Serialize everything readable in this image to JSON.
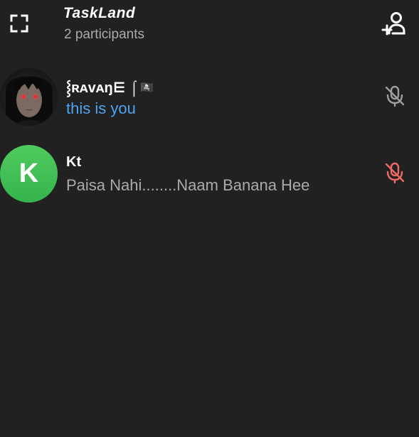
{
  "header": {
    "title": "TaskLand",
    "subtitle": "2 participants",
    "fullscreen_icon": "fullscreen-icon",
    "add_participant_icon": "add-user-icon"
  },
  "participants": [
    {
      "name": "⸾ʀᴀᴠᴀŋ⋿ ⌠",
      "badge": "🏴‍☠️",
      "status": "this is you",
      "avatar_type": "photo",
      "mic_icon": "mic-muted-icon",
      "mic_color": "#9e9e9e"
    },
    {
      "name": "Kt",
      "status": "Paisa Nahi........Naam Banana Hee",
      "avatar_letter": "K",
      "avatar_color": "#43c158",
      "mic_icon": "mic-muted-icon",
      "mic_color": "#ef6a66"
    }
  ],
  "colors": {
    "background": "#212121",
    "self_status": "#4ea4f0",
    "secondary_text": "#aaaaaa",
    "muted_red": "#ef6a66"
  }
}
